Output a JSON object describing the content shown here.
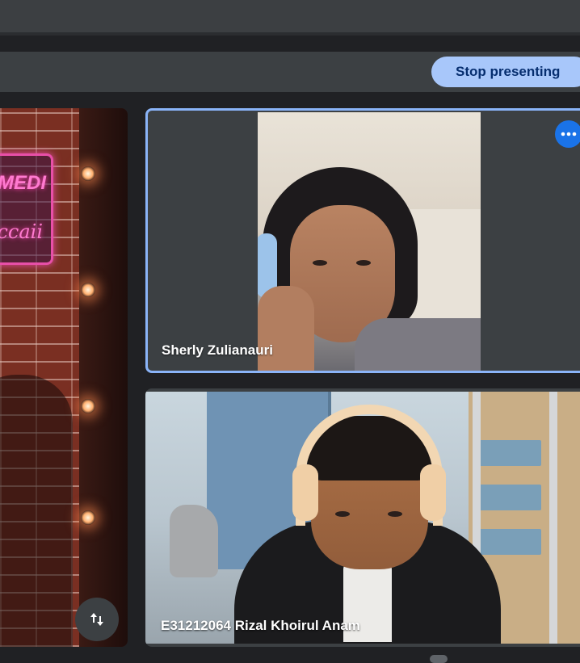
{
  "toolbar": {
    "stop_presenting_label": "Stop presenting"
  },
  "presentation": {
    "neon_line1": "MEDI",
    "neon_line2": "ccaii",
    "swap_icon": "swap-vert-icon"
  },
  "participants": [
    {
      "name": "Sherly Zulianauri",
      "active_speaker": true,
      "menu_icon": "more-horiz-icon"
    },
    {
      "name": "E31212064 Rizal Khoirul Anam",
      "active_speaker": false
    }
  ],
  "colors": {
    "background": "#202124",
    "tile_background": "#3c4043",
    "active_border": "#8ab4f8",
    "stop_button_bg": "#a8c7fa",
    "stop_button_text": "#062e6f",
    "menu_button_bg": "#1a73e8"
  }
}
